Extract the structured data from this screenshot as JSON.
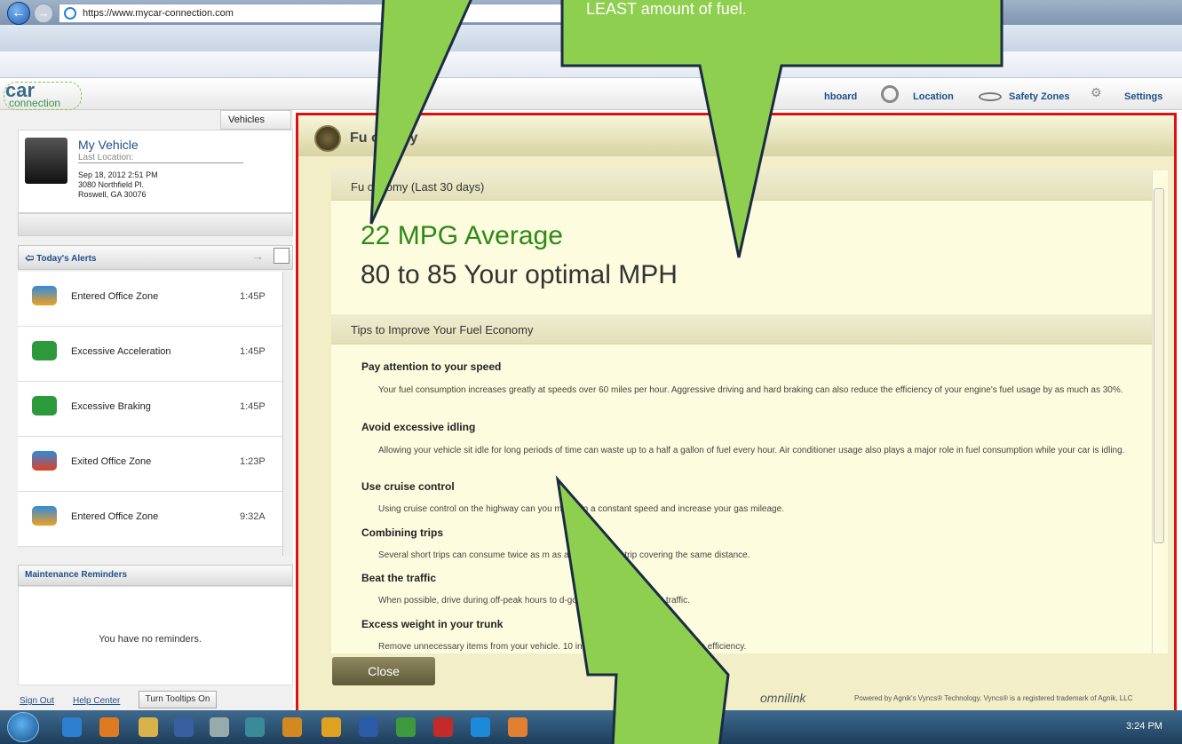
{
  "browser": {
    "url": "https://www.mycar-connection.com"
  },
  "app": {
    "logo_top": "car",
    "logo_bottom": "connection",
    "nav": {
      "dashboard": "hboard",
      "location": "Location",
      "safety": "Safety Zones",
      "settings": "Settings"
    },
    "vehicles_tab": "Vehicles",
    "vehicle": {
      "name": "My Vehicle",
      "last_location_label": "Last Location:",
      "date": "Sep 18, 2012 2:51 PM",
      "street": "3080 Northfield Pl.",
      "city": "Roswell, GA 30076"
    },
    "alerts_title": "Today's Alerts",
    "alerts": [
      {
        "label": "Entered Office Zone",
        "time": "1:45P"
      },
      {
        "label": "Excessive Acceleration",
        "time": "1:45P"
      },
      {
        "label": "Excessive Braking",
        "time": "1:45P"
      },
      {
        "label": "Exited Office Zone",
        "time": "1:23P"
      },
      {
        "label": "Entered Office Zone",
        "time": "9:32A"
      }
    ],
    "maintenance_title": "Maintenance Reminders",
    "maintenance_empty": "You have no reminders.",
    "footer": {
      "signout": "Sign Out",
      "help": "Help Center",
      "tooltips": "Turn Tooltips On"
    }
  },
  "modal": {
    "title": "Fu      onomy",
    "section1": "Fu      conomy (Last 30 days)",
    "avg": "22 MPG Average",
    "optimal": "80 to 85 Your optimal MPH",
    "section2": "Tips to Improve Your Fuel Economy",
    "tips": [
      {
        "title": "Pay attention to your speed",
        "body": "Your fuel consumption increases greatly at speeds over 60 miles per hour. Aggressive driving and hard braking can also reduce the efficiency of your engine's fuel usage by as much as 30%."
      },
      {
        "title": "Avoid excessive idling",
        "body": "Allowing your vehicle sit idle for long periods of time can waste up to a half a gallon of fuel every hour. Air conditioner usage also plays a major role in fuel consumption while your car is idling."
      },
      {
        "title": "Use cruise control",
        "body": "Using cruise control on the highway can      you maintain a constant speed and increase your gas mileage."
      },
      {
        "title": "Combining trips",
        "body": "Several short trips can consume twice as m          as a multipurpose trip covering the same distance."
      },
      {
        "title": "Beat the traffic",
        "body": "When possible, drive during off-peak hours to                 d-go or bumper-to-bumper traffic."
      },
      {
        "title": "Excess weight in your trunk",
        "body": "Remove unnecessary items from your vehicle. 10                  in your trunk will reduce your gas efficiency."
      }
    ],
    "close": "Close",
    "brand": "omnilink",
    "powered": "Powered by Agnik's Vyncs® Technology. Vyncs® is a registered trademark of Agnik, LLC"
  },
  "callout_top_right": "LEAST amount of fuel.",
  "taskbar": {
    "clock": "3:24 PM"
  },
  "colors": {
    "highlight_border": "#e01010",
    "callout_fill": "#8fcf4f",
    "avg_green": "#2c8a16"
  }
}
